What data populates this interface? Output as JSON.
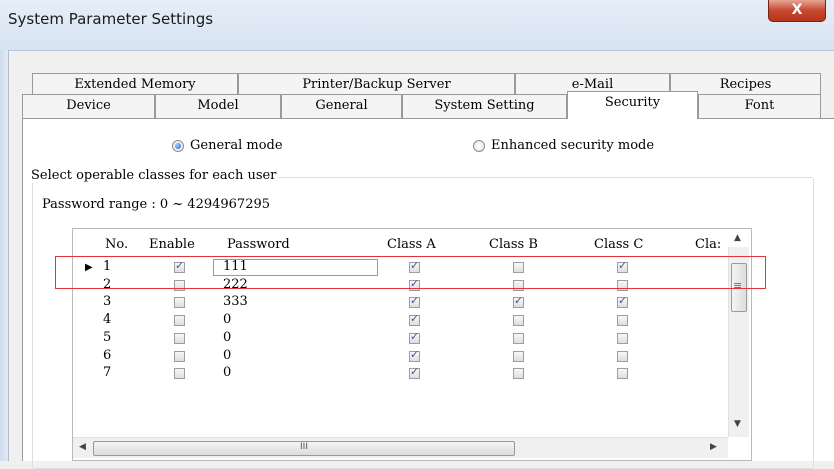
{
  "window": {
    "title": "System Parameter Settings",
    "close_glyph": "X"
  },
  "tabs_row1": [
    "Extended Memory",
    "Printer/Backup Server",
    "e-Mail",
    "Recipes"
  ],
  "tabs_row2": [
    "Device",
    "Model",
    "General",
    "System Setting",
    "Security",
    "Font"
  ],
  "active_tab": "Security",
  "mode": {
    "general_label": "General mode",
    "enhanced_label": "Enhanced security mode",
    "selected": "general"
  },
  "group": {
    "legend": "Select operable classes for each user",
    "password_range": "Password range : 0 ~ 4294967295"
  },
  "grid": {
    "headers": [
      "No.",
      "Enable",
      "Password",
      "Class A",
      "Class B",
      "Class C",
      "Cla:"
    ],
    "rows": [
      {
        "no": "1",
        "enable": true,
        "password": "111",
        "a": true,
        "b": false,
        "c": true
      },
      {
        "no": "2",
        "enable": false,
        "password": "222",
        "a": true,
        "b": false,
        "c": false
      },
      {
        "no": "3",
        "enable": false,
        "password": "333",
        "a": true,
        "b": true,
        "c": true
      },
      {
        "no": "4",
        "enable": false,
        "password": "0",
        "a": true,
        "b": false,
        "c": false
      },
      {
        "no": "5",
        "enable": false,
        "password": "0",
        "a": true,
        "b": false,
        "c": false
      },
      {
        "no": "6",
        "enable": false,
        "password": "0",
        "a": true,
        "b": false,
        "c": false
      },
      {
        "no": "7",
        "enable": false,
        "password": "0",
        "a": true,
        "b": false,
        "c": false
      }
    ],
    "hscroll_grip": "III",
    "vscroll_grip": "≡"
  },
  "colors": {
    "highlight": "#e0353b",
    "close_button": "#c6492f"
  }
}
